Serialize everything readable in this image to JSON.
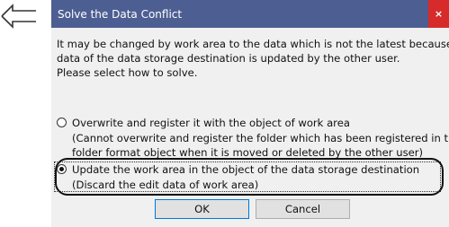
{
  "dialog": {
    "title": "Solve the Data Conflict",
    "close_glyph": "×",
    "message_lines": [
      "It may be changed by work area to the data which is not the latest because the",
      "data of the data storage destination is updated by the other user.",
      "Please select how to solve."
    ],
    "option_overwrite": {
      "lines": [
        "Overwrite and register it with the object of work area",
        "(Cannot overwrite and register the folder which has been registered in the",
        "folder format object when it is moved or deleted by the other user)"
      ],
      "selected": false
    },
    "option_update": {
      "lines": [
        "Update the work area in the object of the data storage destination",
        "(Discard the edit data of work area)"
      ],
      "selected": true
    },
    "ok_label": "OK",
    "cancel_label": "Cancel"
  },
  "colors": {
    "titlebar": "#4d5f92",
    "close": "#d72b2b",
    "dialog_bg": "#f0f0f0"
  }
}
